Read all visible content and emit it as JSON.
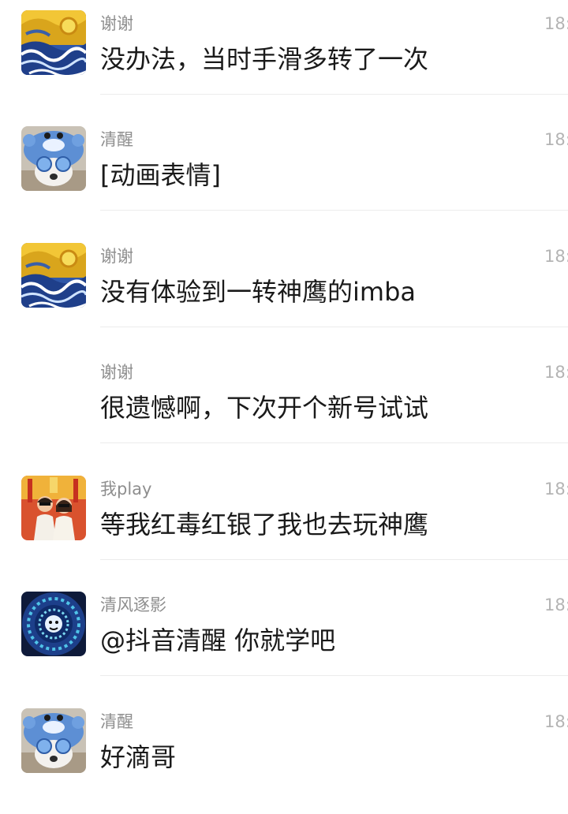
{
  "messages": [
    {
      "sender": "谢谢",
      "text": "没办法，当时手滑多转了一次",
      "time": "18:",
      "avatar": "starry-wave-avatar-icon"
    },
    {
      "sender": "清醒",
      "text": "[动画表情]",
      "time": "18:",
      "avatar": "blue-hat-dog-avatar-icon"
    },
    {
      "sender": "谢谢",
      "text": "没有体验到一转神鹰的imba",
      "time": "18:",
      "avatar": "starry-wave-avatar-icon"
    },
    {
      "sender": "谢谢",
      "text": "很遗憾啊，下次开个新号试试",
      "time": "18:",
      "avatar": ""
    },
    {
      "sender": "我play",
      "text": "等我红毒红银了我也去玩神鹰",
      "time": "18:",
      "avatar": "couple-photo-avatar-icon"
    },
    {
      "sender": "清风逐影",
      "text": "@抖音清醒 你就学吧",
      "time": "18:",
      "avatar": "kaleidoscope-avatar-icon"
    },
    {
      "sender": "清醒",
      "text": "好滴哥",
      "time": "18:",
      "avatar": "blue-hat-dog-avatar-icon"
    }
  ]
}
